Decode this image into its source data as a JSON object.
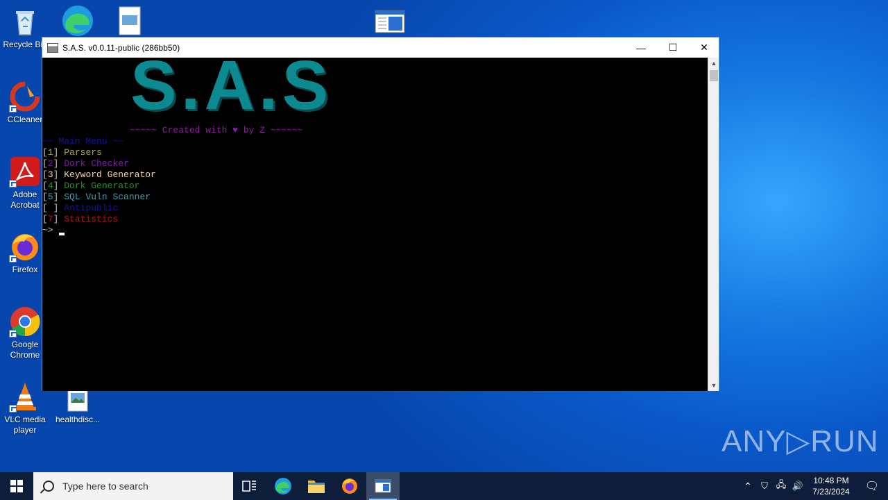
{
  "desktop": {
    "icons": [
      {
        "label": "Recycle Bin"
      },
      {
        "label": "CCleaner"
      },
      {
        "label": "Adobe Acrobat"
      },
      {
        "label": "Firefox"
      },
      {
        "label": "Google Chrome"
      },
      {
        "label": "VLC media player"
      },
      {
        "label": "healthdisc..."
      }
    ]
  },
  "window": {
    "title": "S.A.S. v0.0.11-public (286bb50)",
    "minimize_glyph": "—",
    "maximize_glyph": "☐",
    "close_glyph": "✕"
  },
  "console": {
    "logo_text": "S.A.S",
    "tagline": "~~~~~ Created with ♥ by Z ~~~~~~",
    "menu_title": "~~ Main Menu ~~",
    "items": [
      {
        "num": "1",
        "label": "Parsers",
        "color": "#a9a83a"
      },
      {
        "num": "2",
        "label": "Dork Checker",
        "color": "#7a1fa2"
      },
      {
        "num": "3",
        "label": "Keyword Generator",
        "color": "#f2d6a8"
      },
      {
        "num": "4",
        "label": "Dork Generator",
        "color": "#2a8f2a"
      },
      {
        "num": "5",
        "label": "SQL Vuln Scanner",
        "color": "#3c9fae"
      },
      {
        "num": " ",
        "label": "Antipublic",
        "color": "#14149c"
      },
      {
        "num": "7",
        "label": "Statistics",
        "color": "#b01a1a"
      }
    ],
    "prompt": "~>"
  },
  "taskbar": {
    "search_placeholder": "Type here to search",
    "time": "10:48 PM",
    "date": "7/23/2024"
  },
  "watermark": "ANY▷RUN",
  "colors": {
    "logo": "#0d8a8f",
    "tagline": "#8a1f9c",
    "menu_title": "#14149c",
    "bracket": "#c0c0c0"
  }
}
